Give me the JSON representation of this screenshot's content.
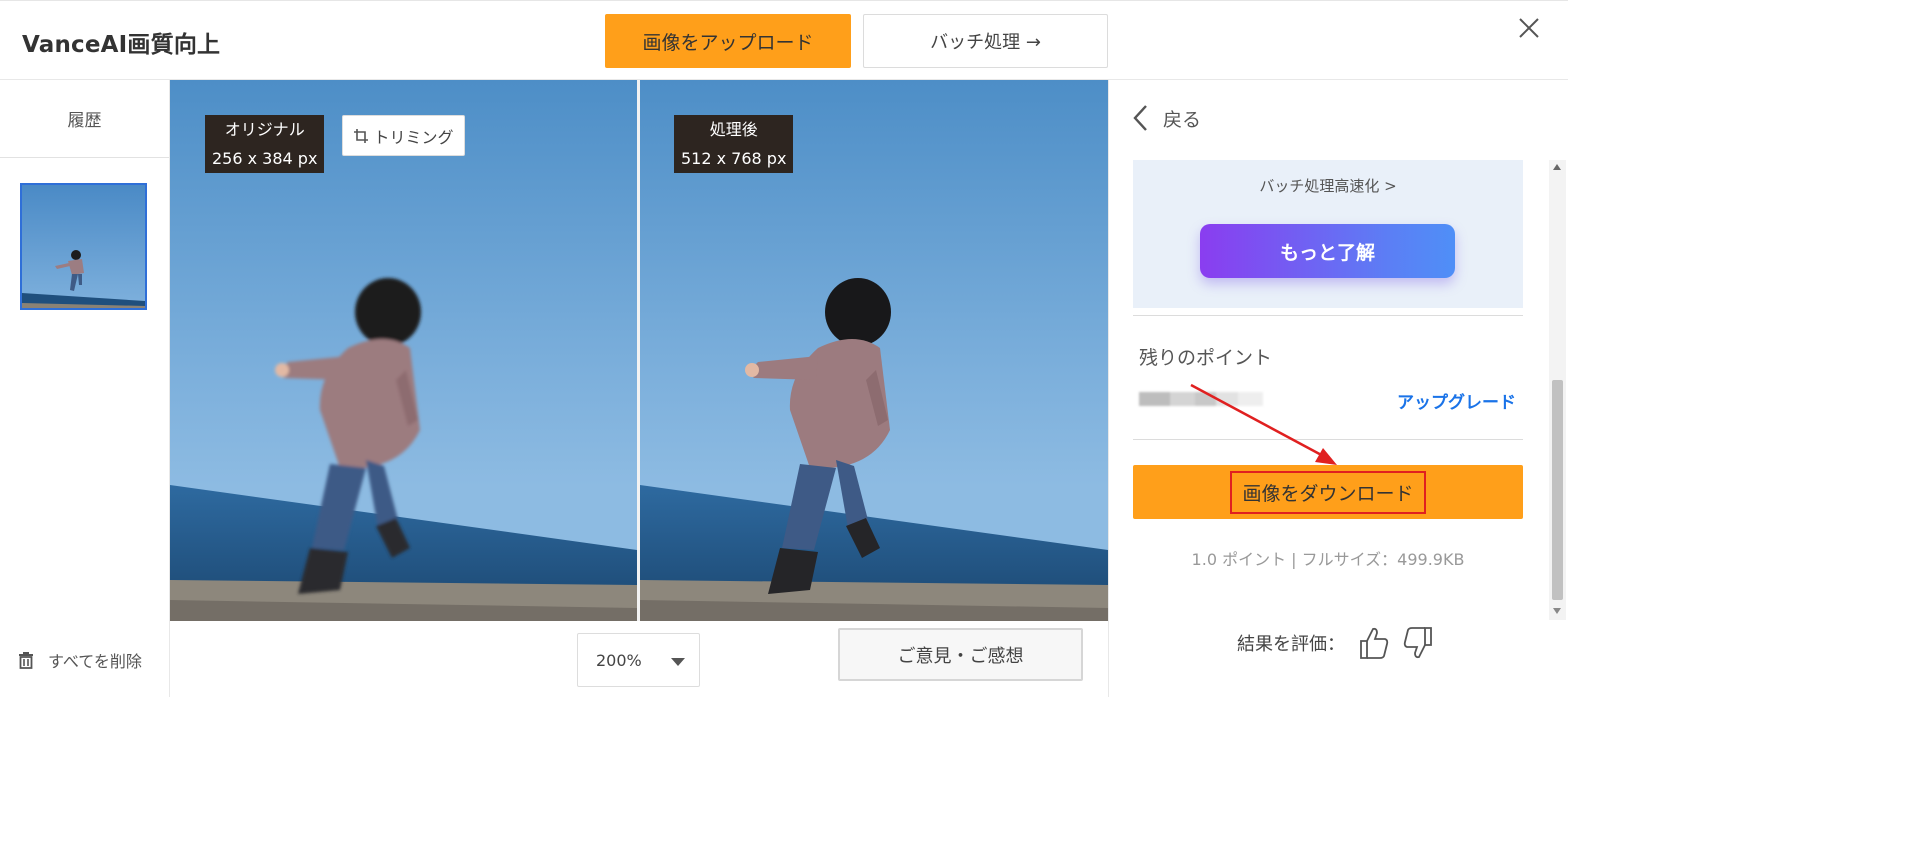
{
  "header": {
    "brand": "VanceAI画質向上",
    "upload_label": "画像をアップロード",
    "batch_label": "バッチ処理 →"
  },
  "sidebar": {
    "history_label": "履歴",
    "delete_all_label": "すべてを削除"
  },
  "compare": {
    "original_label": "オリジナル",
    "original_size": "256 x 384 px",
    "crop_label": "トリミング",
    "processed_label": "処理後",
    "processed_size": "512 x 768 px"
  },
  "bottom": {
    "zoom_value": "200%",
    "feedback_label": "ご意見・ご感想"
  },
  "right_panel": {
    "back_label": "戻る",
    "promo_link": "バッチ処理高速化 >",
    "more_button": "もっと了解",
    "points_title": "残りのポイント",
    "upgrade_label": "アップグレード",
    "download_label": "画像をダウンロード",
    "download_info": "1.0 ポイント | フルサイズ：499.9KB",
    "rate_label": "結果を評価："
  },
  "colors": {
    "accent_orange": "#ff9f1a",
    "link_blue": "#1a73e8",
    "gradient_start": "#8a3df0",
    "gradient_end": "#4f8ff7",
    "annotation_red": "#e02020"
  },
  "icons": [
    "close-icon",
    "trash-icon",
    "crop-icon",
    "chevron-left-icon",
    "chevron-down-icon",
    "thumbs-up-icon",
    "thumbs-down-icon"
  ]
}
